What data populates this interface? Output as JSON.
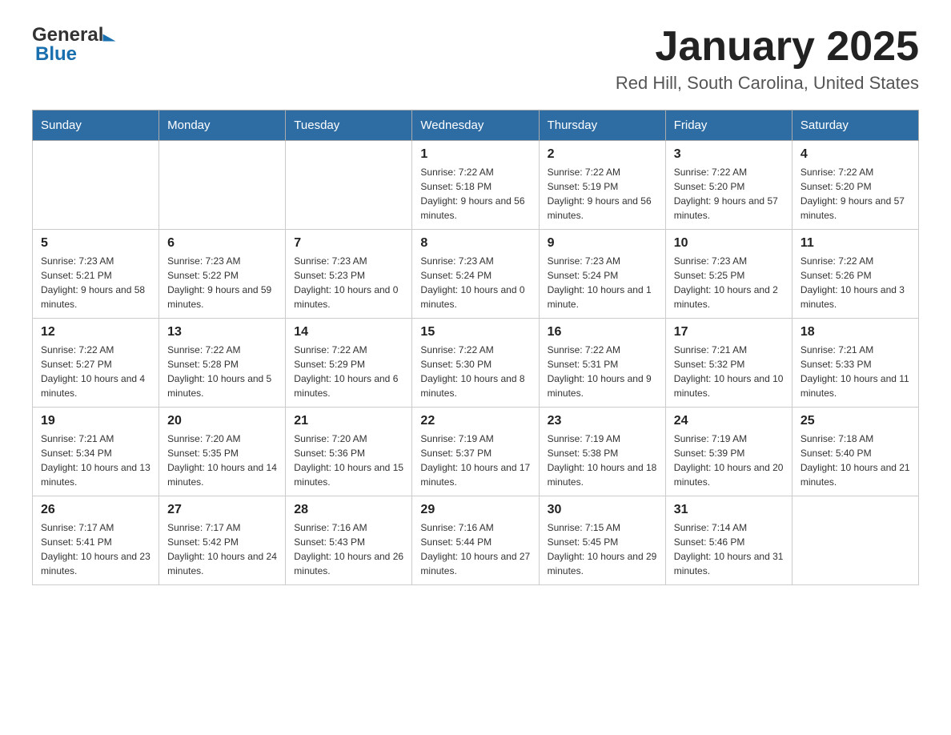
{
  "header": {
    "logo_general": "General",
    "logo_arrow": "▶",
    "logo_blue": "Blue",
    "month_title": "January 2025",
    "location": "Red Hill, South Carolina, United States"
  },
  "days_of_week": [
    "Sunday",
    "Monday",
    "Tuesday",
    "Wednesday",
    "Thursday",
    "Friday",
    "Saturday"
  ],
  "weeks": [
    [
      {
        "day": "",
        "sunrise": "",
        "sunset": "",
        "daylight": ""
      },
      {
        "day": "",
        "sunrise": "",
        "sunset": "",
        "daylight": ""
      },
      {
        "day": "",
        "sunrise": "",
        "sunset": "",
        "daylight": ""
      },
      {
        "day": "1",
        "sunrise": "Sunrise: 7:22 AM",
        "sunset": "Sunset: 5:18 PM",
        "daylight": "Daylight: 9 hours and 56 minutes."
      },
      {
        "day": "2",
        "sunrise": "Sunrise: 7:22 AM",
        "sunset": "Sunset: 5:19 PM",
        "daylight": "Daylight: 9 hours and 56 minutes."
      },
      {
        "day": "3",
        "sunrise": "Sunrise: 7:22 AM",
        "sunset": "Sunset: 5:20 PM",
        "daylight": "Daylight: 9 hours and 57 minutes."
      },
      {
        "day": "4",
        "sunrise": "Sunrise: 7:22 AM",
        "sunset": "Sunset: 5:20 PM",
        "daylight": "Daylight: 9 hours and 57 minutes."
      }
    ],
    [
      {
        "day": "5",
        "sunrise": "Sunrise: 7:23 AM",
        "sunset": "Sunset: 5:21 PM",
        "daylight": "Daylight: 9 hours and 58 minutes."
      },
      {
        "day": "6",
        "sunrise": "Sunrise: 7:23 AM",
        "sunset": "Sunset: 5:22 PM",
        "daylight": "Daylight: 9 hours and 59 minutes."
      },
      {
        "day": "7",
        "sunrise": "Sunrise: 7:23 AM",
        "sunset": "Sunset: 5:23 PM",
        "daylight": "Daylight: 10 hours and 0 minutes."
      },
      {
        "day": "8",
        "sunrise": "Sunrise: 7:23 AM",
        "sunset": "Sunset: 5:24 PM",
        "daylight": "Daylight: 10 hours and 0 minutes."
      },
      {
        "day": "9",
        "sunrise": "Sunrise: 7:23 AM",
        "sunset": "Sunset: 5:24 PM",
        "daylight": "Daylight: 10 hours and 1 minute."
      },
      {
        "day": "10",
        "sunrise": "Sunrise: 7:23 AM",
        "sunset": "Sunset: 5:25 PM",
        "daylight": "Daylight: 10 hours and 2 minutes."
      },
      {
        "day": "11",
        "sunrise": "Sunrise: 7:22 AM",
        "sunset": "Sunset: 5:26 PM",
        "daylight": "Daylight: 10 hours and 3 minutes."
      }
    ],
    [
      {
        "day": "12",
        "sunrise": "Sunrise: 7:22 AM",
        "sunset": "Sunset: 5:27 PM",
        "daylight": "Daylight: 10 hours and 4 minutes."
      },
      {
        "day": "13",
        "sunrise": "Sunrise: 7:22 AM",
        "sunset": "Sunset: 5:28 PM",
        "daylight": "Daylight: 10 hours and 5 minutes."
      },
      {
        "day": "14",
        "sunrise": "Sunrise: 7:22 AM",
        "sunset": "Sunset: 5:29 PM",
        "daylight": "Daylight: 10 hours and 6 minutes."
      },
      {
        "day": "15",
        "sunrise": "Sunrise: 7:22 AM",
        "sunset": "Sunset: 5:30 PM",
        "daylight": "Daylight: 10 hours and 8 minutes."
      },
      {
        "day": "16",
        "sunrise": "Sunrise: 7:22 AM",
        "sunset": "Sunset: 5:31 PM",
        "daylight": "Daylight: 10 hours and 9 minutes."
      },
      {
        "day": "17",
        "sunrise": "Sunrise: 7:21 AM",
        "sunset": "Sunset: 5:32 PM",
        "daylight": "Daylight: 10 hours and 10 minutes."
      },
      {
        "day": "18",
        "sunrise": "Sunrise: 7:21 AM",
        "sunset": "Sunset: 5:33 PM",
        "daylight": "Daylight: 10 hours and 11 minutes."
      }
    ],
    [
      {
        "day": "19",
        "sunrise": "Sunrise: 7:21 AM",
        "sunset": "Sunset: 5:34 PM",
        "daylight": "Daylight: 10 hours and 13 minutes."
      },
      {
        "day": "20",
        "sunrise": "Sunrise: 7:20 AM",
        "sunset": "Sunset: 5:35 PM",
        "daylight": "Daylight: 10 hours and 14 minutes."
      },
      {
        "day": "21",
        "sunrise": "Sunrise: 7:20 AM",
        "sunset": "Sunset: 5:36 PM",
        "daylight": "Daylight: 10 hours and 15 minutes."
      },
      {
        "day": "22",
        "sunrise": "Sunrise: 7:19 AM",
        "sunset": "Sunset: 5:37 PM",
        "daylight": "Daylight: 10 hours and 17 minutes."
      },
      {
        "day": "23",
        "sunrise": "Sunrise: 7:19 AM",
        "sunset": "Sunset: 5:38 PM",
        "daylight": "Daylight: 10 hours and 18 minutes."
      },
      {
        "day": "24",
        "sunrise": "Sunrise: 7:19 AM",
        "sunset": "Sunset: 5:39 PM",
        "daylight": "Daylight: 10 hours and 20 minutes."
      },
      {
        "day": "25",
        "sunrise": "Sunrise: 7:18 AM",
        "sunset": "Sunset: 5:40 PM",
        "daylight": "Daylight: 10 hours and 21 minutes."
      }
    ],
    [
      {
        "day": "26",
        "sunrise": "Sunrise: 7:17 AM",
        "sunset": "Sunset: 5:41 PM",
        "daylight": "Daylight: 10 hours and 23 minutes."
      },
      {
        "day": "27",
        "sunrise": "Sunrise: 7:17 AM",
        "sunset": "Sunset: 5:42 PM",
        "daylight": "Daylight: 10 hours and 24 minutes."
      },
      {
        "day": "28",
        "sunrise": "Sunrise: 7:16 AM",
        "sunset": "Sunset: 5:43 PM",
        "daylight": "Daylight: 10 hours and 26 minutes."
      },
      {
        "day": "29",
        "sunrise": "Sunrise: 7:16 AM",
        "sunset": "Sunset: 5:44 PM",
        "daylight": "Daylight: 10 hours and 27 minutes."
      },
      {
        "day": "30",
        "sunrise": "Sunrise: 7:15 AM",
        "sunset": "Sunset: 5:45 PM",
        "daylight": "Daylight: 10 hours and 29 minutes."
      },
      {
        "day": "31",
        "sunrise": "Sunrise: 7:14 AM",
        "sunset": "Sunset: 5:46 PM",
        "daylight": "Daylight: 10 hours and 31 minutes."
      },
      {
        "day": "",
        "sunrise": "",
        "sunset": "",
        "daylight": ""
      }
    ]
  ]
}
